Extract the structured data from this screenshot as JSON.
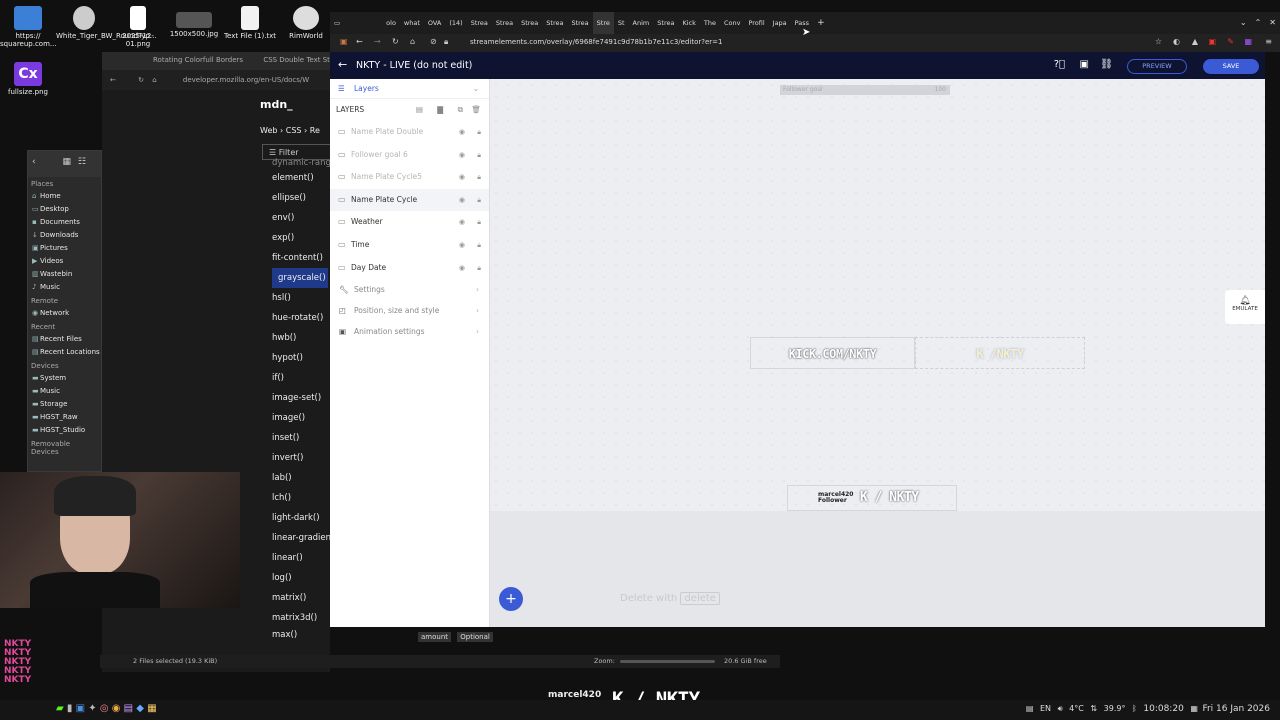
{
  "desktop": {
    "icons": [
      {
        "label": "https://\nsquareup.com..."
      },
      {
        "label": "White_Tiger_BW_RoundTyp..."
      },
      {
        "label": "2025-12-01.png"
      },
      {
        "label": "1500x500.jpg"
      },
      {
        "label": "Text File (1).txt"
      },
      {
        "label": "RimWorld"
      },
      {
        "label": "fullsize.png"
      }
    ],
    "cx_label": "Cx"
  },
  "file_manager": {
    "places_header": "Places",
    "places": [
      "Home",
      "Desktop",
      "Documents",
      "Downloads",
      "Pictures",
      "Videos",
      "Wastebin",
      "Music"
    ],
    "remote_header": "Remote",
    "remote": [
      "Network"
    ],
    "recent_header": "Recent",
    "recent": [
      "Recent Files",
      "Recent Locations"
    ],
    "devices_header": "Devices",
    "devices": [
      "System",
      "Music",
      "Storage",
      "HGST_Raw",
      "HGST_Studio"
    ],
    "removable_header": "Removable Devices",
    "status": "2 Files selected (19.3 KiB)",
    "zoom_label": "Zoom:",
    "free_space": "20.6 GiB free"
  },
  "mdn": {
    "tabs": [
      "Rotating Colorfull Borders",
      "CSS Double Text St"
    ],
    "url": "developer.mozilla.org/en-US/docs/W",
    "logo": "mdn_",
    "breadcrumb": [
      "Web",
      "CSS",
      "Re"
    ],
    "filter_placeholder": "Filter",
    "items": [
      "dynamic-range",
      "element()",
      "ellipse()",
      "env()",
      "exp()",
      "fit-content()",
      "grayscale()",
      "hsl()",
      "hue-rotate()",
      "hwb()",
      "hypot()",
      "if()",
      "image-set()",
      "image()",
      "inset()",
      "invert()",
      "lab()",
      "lch()",
      "light-dark()",
      "linear-gradient",
      "linear()",
      "log()",
      "matrix()",
      "matrix3d()",
      "max()"
    ],
    "selected_item": "grayscale()",
    "hint_amount": "amount",
    "hint_optional": "Optional"
  },
  "browser": {
    "tabs": [
      "olo",
      "what",
      "OVA",
      "(14)",
      "Strea",
      "Strea",
      "Strea",
      "Strea",
      "Strea",
      "Stre",
      "St",
      "Anim",
      "Strea",
      "Kick",
      "The",
      "Conv",
      "Profil",
      "Japa",
      "Pass"
    ],
    "url": "streamelements.com/overlay/6968fe7491c9d78b1b7e11c3/editor?er=1"
  },
  "editor": {
    "title": "NKTY - LIVE (do not edit)",
    "preview_label": "PREVIEW",
    "save_label": "SAVE",
    "layers_title": "Layers",
    "layers_subtitle": "LAYERS",
    "layers": [
      {
        "name": "Name Plate Double",
        "faded": true
      },
      {
        "name": "Follower goal 6",
        "faded": true
      },
      {
        "name": "Name Plate Cycle5",
        "faded": true
      },
      {
        "name": "Name Plate Cycle",
        "faded": false
      },
      {
        "name": "Weather",
        "faded": false
      },
      {
        "name": "Time",
        "faded": false
      },
      {
        "name": "Day Date",
        "faded": false
      }
    ],
    "sections": [
      "Settings",
      "Position, size and style",
      "Animation settings"
    ],
    "canvas": {
      "follower_goal_label": "Follower goal",
      "follower_goal_max": "100",
      "kick_url": "KICK.COM/NKTY",
      "kick_slash": "K /NKTY",
      "follower_name": "marcel420",
      "follower_role": "Follower",
      "follower_brand": "K / NKTY",
      "delete_hint": "Delete with",
      "delete_key": "delete",
      "emulate_label": "EMULATE"
    }
  },
  "overlay_bottom": {
    "name": "marcel420",
    "role": "Follower",
    "brand": "K / NKTY"
  },
  "chat_overlay": [
    "NKTY",
    "NKTY",
    "NKTY",
    "NKTY",
    "NKTY"
  ],
  "tray": {
    "lang": "EN",
    "temp1": "4°C",
    "temp2": "39.9°",
    "time": "10:08:20",
    "date": "Fri 16 Jan 2026"
  },
  "colors": {
    "accent": "#3b5bd6",
    "kick_green": "#53fc18",
    "editor_header": "#0d1330"
  }
}
